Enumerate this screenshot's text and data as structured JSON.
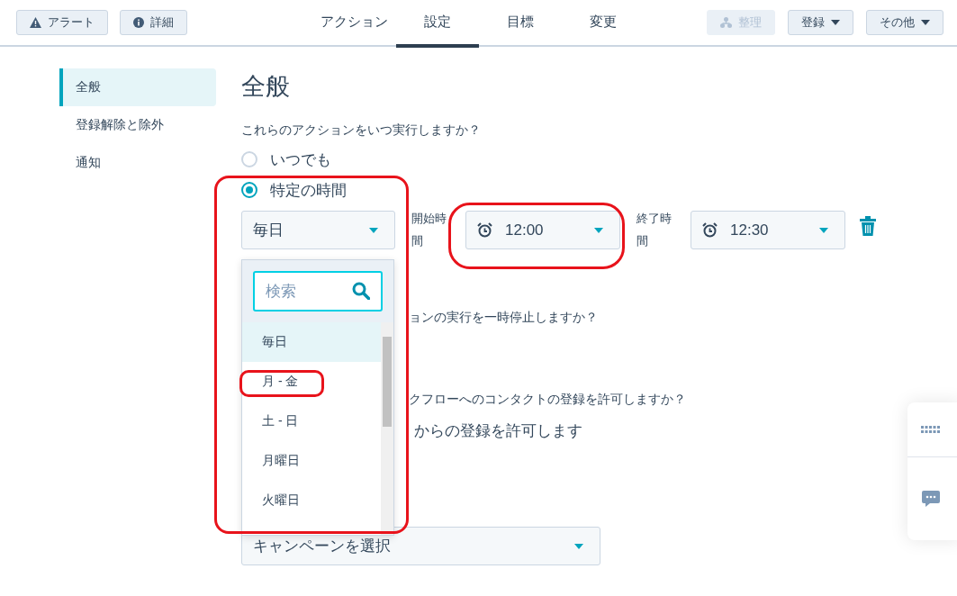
{
  "header": {
    "left_buttons": [
      {
        "label": "アラート"
      },
      {
        "label": "詳細"
      }
    ],
    "tabs": [
      {
        "label": "アクション",
        "selected": false
      },
      {
        "label": "設定",
        "selected": true
      },
      {
        "label": "目標",
        "selected": false
      },
      {
        "label": "変更",
        "selected": false
      }
    ],
    "right_buttons": [
      {
        "label": "整理",
        "disabled": true,
        "caret": false
      },
      {
        "label": "登録",
        "disabled": false,
        "caret": true
      },
      {
        "label": "その他",
        "disabled": false,
        "caret": true
      }
    ]
  },
  "sidebar": {
    "items": [
      {
        "label": "全般",
        "selected": true
      },
      {
        "label": "登録解除と除外",
        "selected": false
      },
      {
        "label": "通知",
        "selected": false
      }
    ]
  },
  "section": {
    "title": "全般",
    "question": "これらのアクションをいつ実行しますか？",
    "radios": [
      {
        "label": "いつでも",
        "selected": false
      },
      {
        "label": "特定の時間",
        "selected": true
      }
    ],
    "schedule": {
      "day": "毎日",
      "start_label": "開始時間",
      "start_time": "12:00",
      "end_label": "終了時間",
      "end_time": "12:30"
    },
    "hidden_lines": [
      {
        "text": "ョンの実行を一時停止しますか？",
        "kind": "question"
      },
      {
        "text": "クフローへのコンタクトの登録を許可しますか？",
        "kind": "question"
      },
      {
        "text": "からの登録を許可します",
        "kind": "option"
      }
    ],
    "campaign_select": {
      "value": "キャンペーンを選択"
    }
  },
  "dropdown": {
    "search_placeholder": "検索",
    "options": [
      {
        "label": "毎日",
        "selected": true
      },
      {
        "label": "月 - 金",
        "selected": false
      },
      {
        "label": "土 - 日",
        "selected": false
      },
      {
        "label": "月曜日",
        "selected": false
      },
      {
        "label": "火曜日",
        "selected": false
      }
    ]
  }
}
